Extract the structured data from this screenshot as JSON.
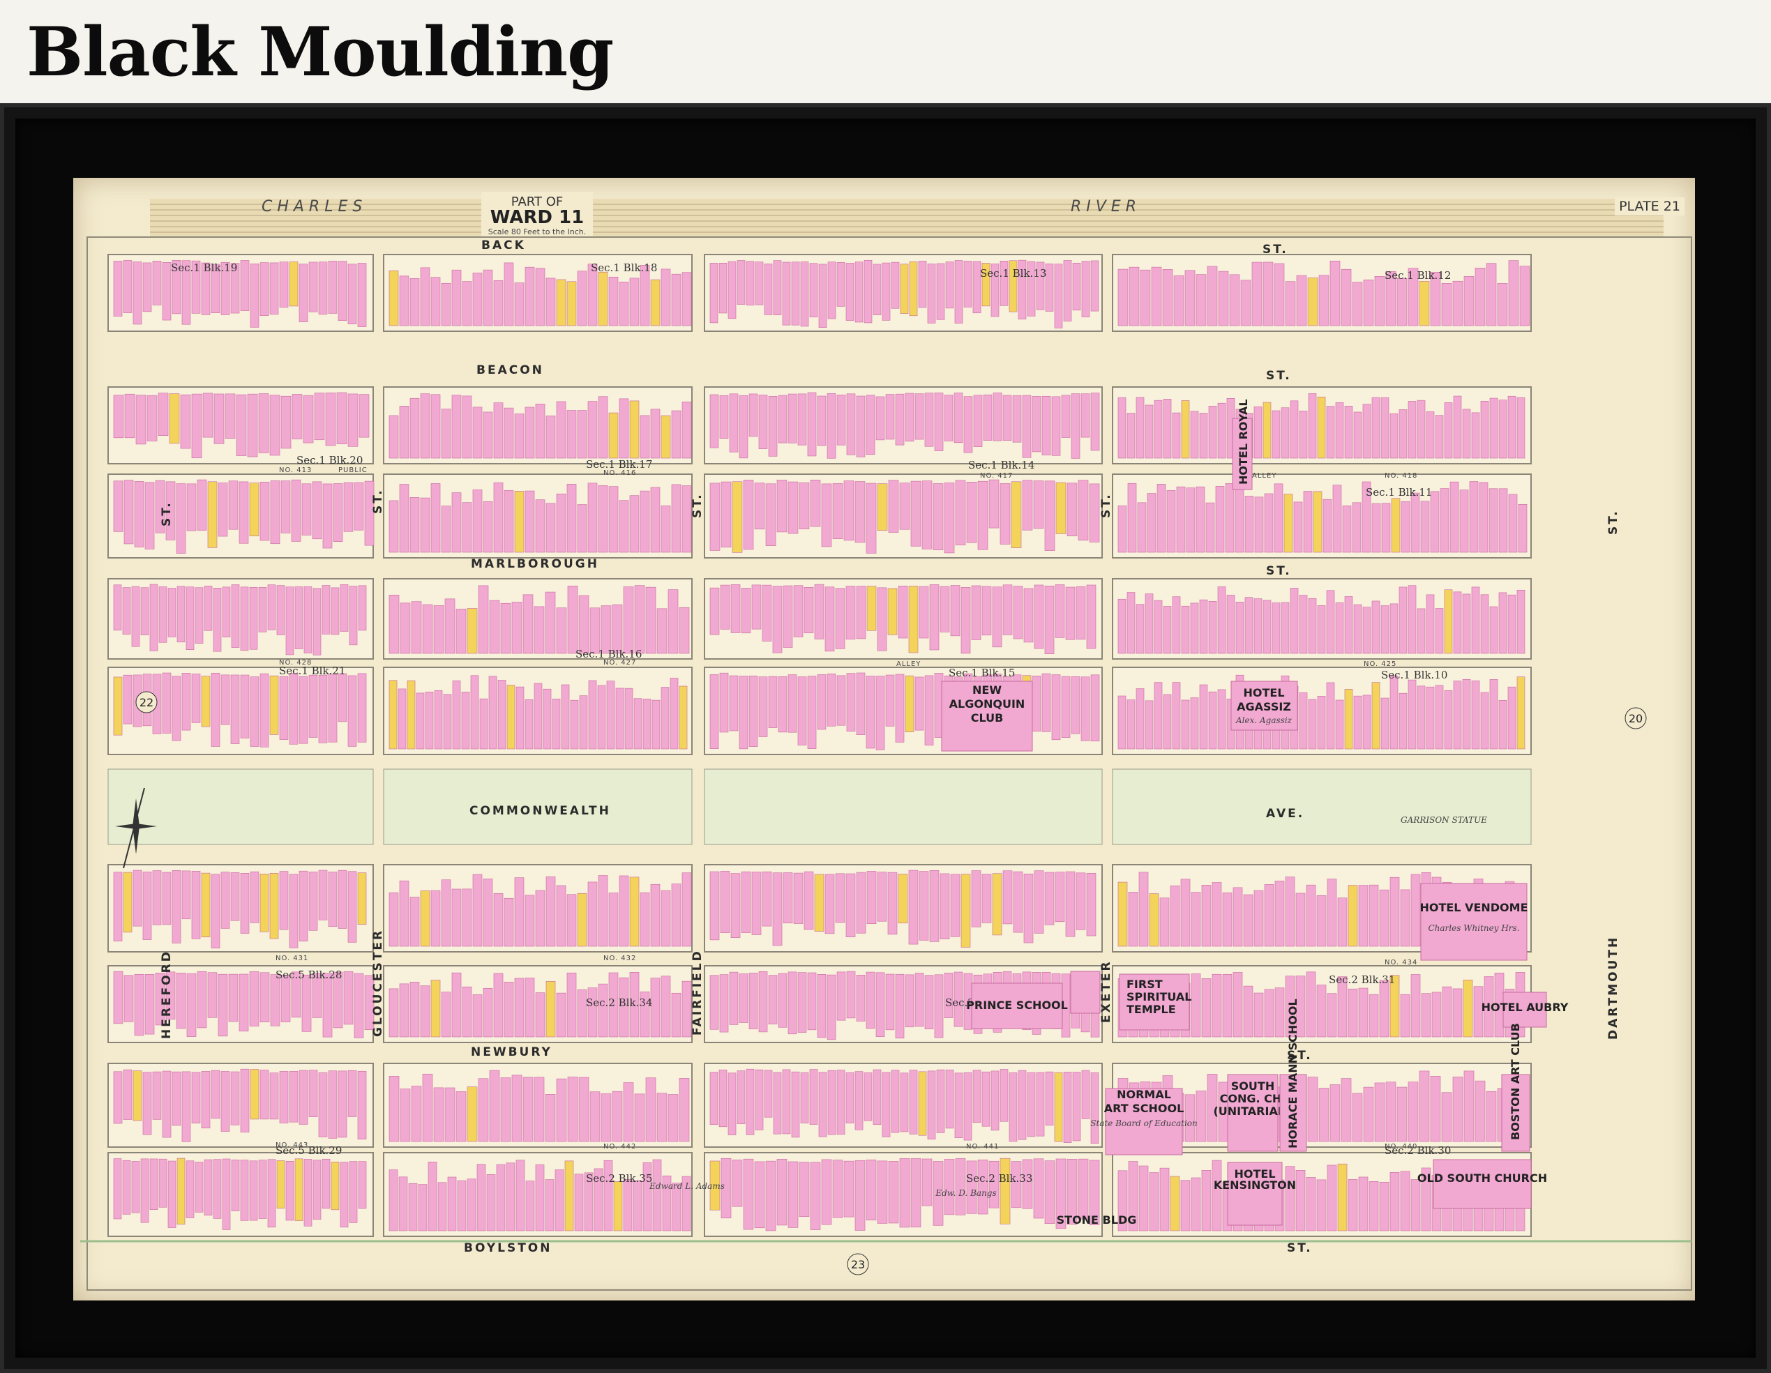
{
  "heading": "Black Moulding",
  "map": {
    "part_of": "PART OF",
    "ward": "WARD 11",
    "scale": "Scale 80 Feet to the Inch.",
    "plate": "PLATE 21",
    "river_left": "C H A R L E S",
    "river_right": "R I V E R",
    "colors": {
      "brick": "#f1a9d2",
      "brick_edge": "#c76a9e",
      "wood": "#f3d35a",
      "paper": "#f4ebcf",
      "park": "#e6edd0",
      "frame": "#141414"
    },
    "streets_h": {
      "back": "BACK",
      "back_st": "ST.",
      "beacon": "BEACON",
      "beacon_st": "ST.",
      "marlborough": "MARLBOROUGH",
      "marlborough_st": "ST.",
      "commonwealth": "COMMONWEALTH",
      "commonwealth_ave": "AVE.",
      "newbury": "NEWBURY",
      "newbury_st": "ST.",
      "boylston": "BOYLSTON",
      "boylston_st": "ST."
    },
    "streets_v": {
      "hereford": "HEREFORD",
      "hereford_st": "ST.",
      "gloucester": "GLOUCESTER",
      "gloucester_st": "ST.",
      "fairfield": "FAIRFIELD",
      "fairfield_st": "ST.",
      "exeter": "EXETER",
      "exeter_st": "ST.",
      "dartmouth": "DARTMOUTH",
      "dartmouth_st": "ST."
    },
    "plate_refs": {
      "left": "22",
      "right": "20",
      "bottom": "23"
    },
    "sections": {
      "s19": "Sec.1 Blk.19",
      "s18": "Sec.1 Blk.18",
      "s13": "Sec.1 Blk.13",
      "s12": "Sec.1 Blk.12",
      "s20": "Sec.1 Blk.20",
      "s17": "Sec.1 Blk.17",
      "s14": "Sec.1 Blk.14",
      "s11": "Sec.1 Blk.11",
      "s16": "Sec.1 Blk.16",
      "s21": "Sec.1 Blk.21",
      "s15": "Sec.1 Blk.15",
      "s10": "Sec.1 Blk.10",
      "s28": "Sec.5 Blk.28",
      "s34": "Sec.2 Blk.34",
      "s32": "Sec.2 Blk.32",
      "s31": "Sec.2 Blk.31",
      "s29": "Sec.5 Blk.29",
      "s35": "Sec.2 Blk.35",
      "s33": "Sec.2 Blk.33",
      "s30": "Sec.2 Blk.30"
    },
    "alleys": {
      "a413": "NO. 413",
      "a416": "NO. 416",
      "a417": "NO. 417",
      "a418": "NO. 418",
      "a428": "NO. 428",
      "a427": "NO. 427",
      "a425": "NO. 425",
      "a431": "NO. 431",
      "a432": "NO. 432",
      "a434": "NO. 434",
      "a443": "NO. 443",
      "a442": "NO. 442",
      "a441": "NO. 441",
      "a440": "NO. 440",
      "public": "PUBLIC",
      "alley": "ALLEY"
    },
    "buildings": {
      "hotel_royal": "HOTEL ROYAL",
      "new_algonquin_1": "NEW",
      "new_algonquin_2": "ALGONQUIN",
      "new_algonquin_3": "CLUB",
      "hotel_agassiz_1": "HOTEL",
      "hotel_agassiz_2": "AGASSIZ",
      "hotel_vendome": "HOTEL VENDOME",
      "prince_school": "PRINCE SCHOOL",
      "first_spiritual_1": "FIRST",
      "first_spiritual_2": "SPIRITUAL",
      "first_spiritual_3": "TEMPLE",
      "hotel_aubry_1": "HOTEL AUBRY",
      "normal_art_1": "NORMAL",
      "normal_art_2": "ART SCHOOL",
      "south_cong_1": "SOUTH",
      "south_cong_2": "CONG. CH.",
      "south_cong_3": "(UNITARIAN)",
      "horace_mann": "HORACE MANN SCHOOL",
      "boston_art": "BOSTON ART CLUB",
      "hotel_kensington_1": "HOTEL",
      "hotel_kensington_2": "KENSINGTON",
      "old_south": "OLD SOUTH CHURCH",
      "stone_bldg": "STONE BLDG",
      "garrison_statue": "GARRISON STATUE"
    },
    "owners": {
      "vendome_owner": "Charles Whitney Hrs.",
      "agassiz_owner": "Alex. Agassiz",
      "normal_owner": "State Board of Education",
      "boylston_owner": "Edward L. Adams",
      "bangs_owner": "Edw. D. Bangs"
    }
  }
}
